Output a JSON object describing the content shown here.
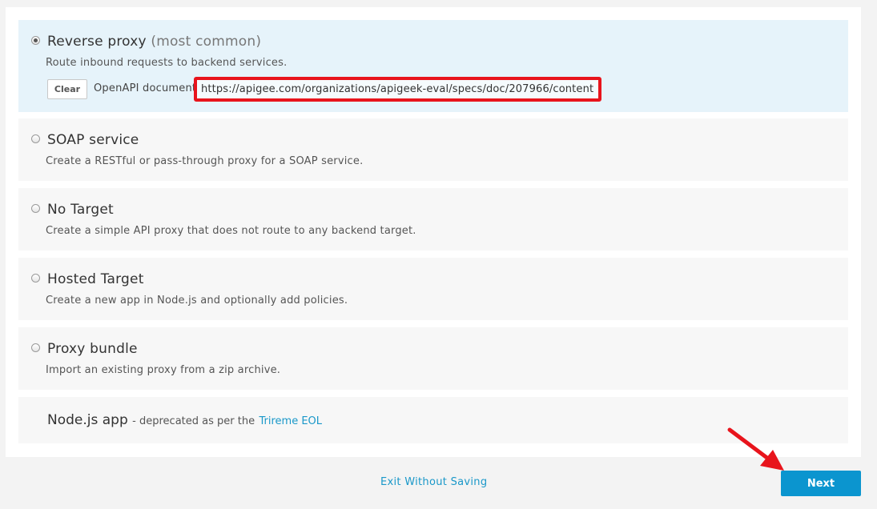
{
  "options": [
    {
      "title": "Reverse proxy",
      "title_note": "(most common)",
      "description": "Route inbound requests to backend services.",
      "checked": true
    },
    {
      "title": "SOAP service",
      "description": "Create a RESTful or pass-through proxy for a SOAP service.",
      "checked": false
    },
    {
      "title": "No Target",
      "description": "Create a simple API proxy that does not route to any backend target.",
      "checked": false
    },
    {
      "title": "Hosted Target",
      "description": "Create a new app in Node.js and optionally add policies.",
      "checked": false
    },
    {
      "title": "Proxy bundle",
      "description": "Import an existing proxy from a zip archive.",
      "checked": false
    }
  ],
  "openapi": {
    "clear_label": "Clear",
    "label": "OpenAPI document",
    "url": "https://apigee.com/organizations/apigeek-eval/specs/doc/207966/content"
  },
  "nodejs": {
    "title": "Node.js app",
    "note": "- deprecated as per the",
    "link_text": "Trireme EOL"
  },
  "footer": {
    "exit_label": "Exit Without Saving",
    "next_label": "Next"
  },
  "colors": {
    "accent": "#0b95cf",
    "link": "#1a98c9",
    "highlight_border": "#e8141c",
    "selected_background": "#e6f3fa"
  }
}
